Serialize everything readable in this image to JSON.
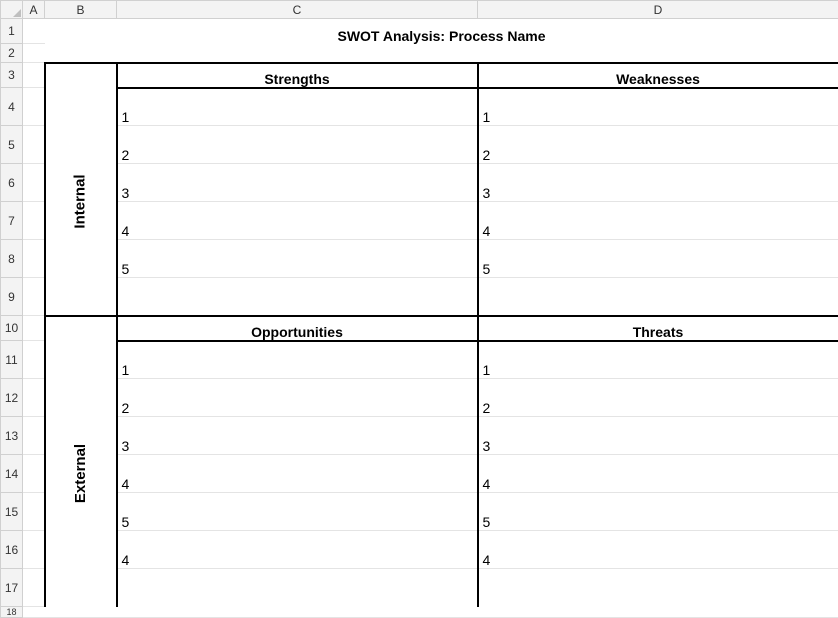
{
  "columns": {
    "A": "A",
    "B": "B",
    "C": "C",
    "D": "D"
  },
  "rows": [
    "1",
    "2",
    "3",
    "4",
    "5",
    "6",
    "7",
    "8",
    "9",
    "10",
    "11",
    "12",
    "13",
    "14",
    "15",
    "16",
    "17",
    "18"
  ],
  "title": "SWOT Analysis:  Process Name",
  "labels": {
    "internal": "Internal",
    "external": "External"
  },
  "quadrants": {
    "strengths": {
      "header": "Strengths",
      "items": [
        "1",
        "2",
        "3",
        "4",
        "5"
      ]
    },
    "weaknesses": {
      "header": "Weaknesses",
      "items": [
        "1",
        "2",
        "3",
        "4",
        "5"
      ]
    },
    "opportunities": {
      "header": "Opportunities",
      "items": [
        "1",
        "2",
        "3",
        "4",
        "5",
        "4"
      ]
    },
    "threats": {
      "header": "Threats",
      "items": [
        "1",
        "2",
        "3",
        "4",
        "5",
        "4"
      ]
    }
  }
}
